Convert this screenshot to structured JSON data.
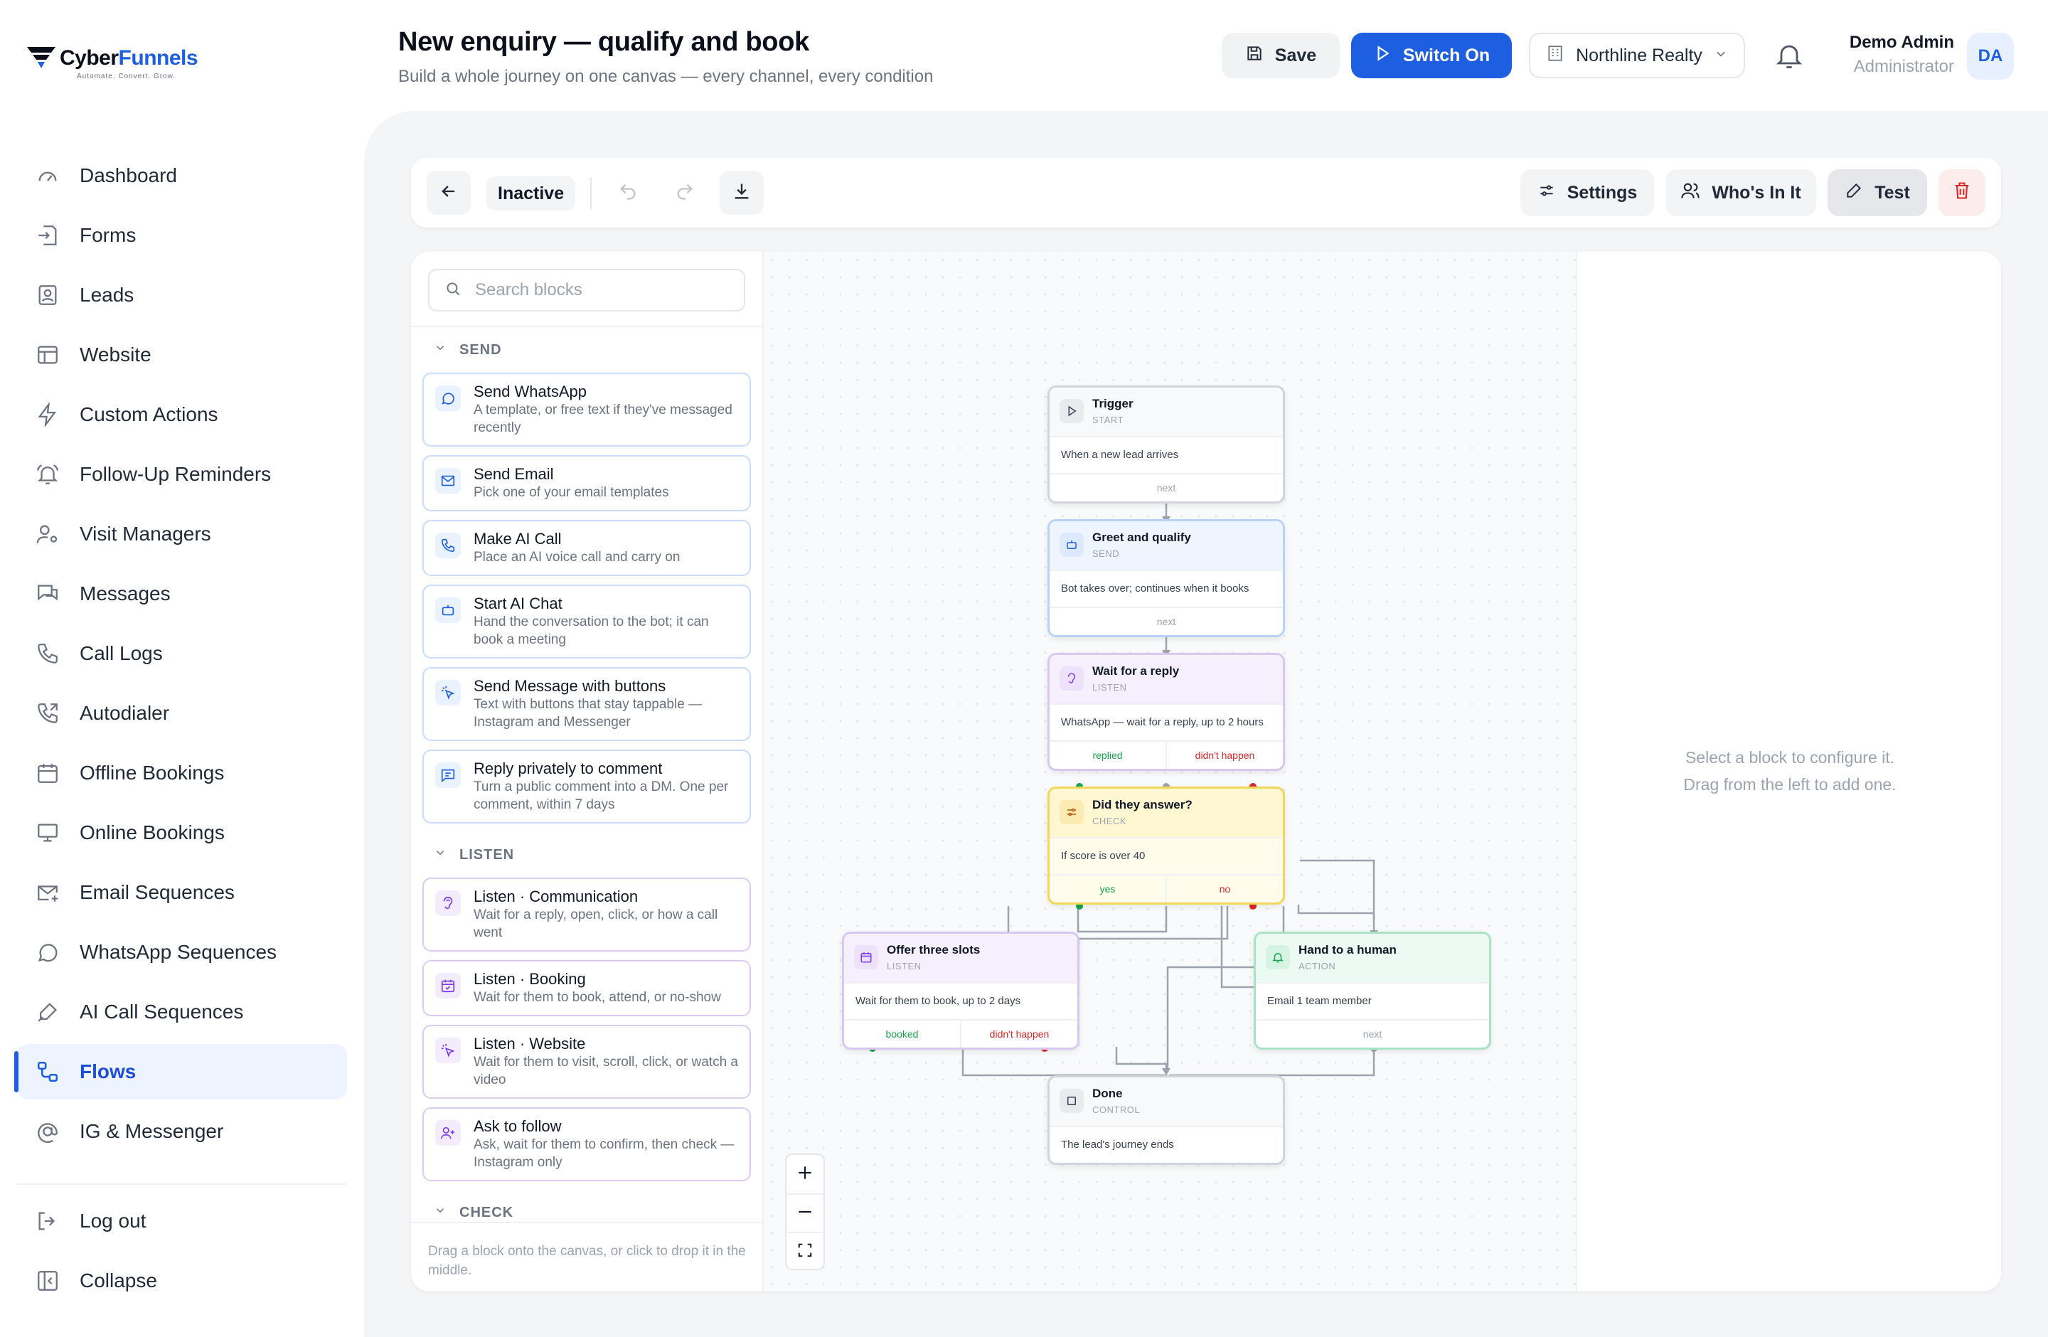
{
  "brand": {
    "name_a": "Cyber",
    "name_b": "Funnels",
    "tagline": "Automate. Convert. Grow."
  },
  "sidebar": {
    "items": [
      {
        "label": "Dashboard",
        "icon": "gauge-icon"
      },
      {
        "label": "Forms",
        "icon": "form-icon"
      },
      {
        "label": "Leads",
        "icon": "contact-card-icon"
      },
      {
        "label": "Website",
        "icon": "layout-icon"
      },
      {
        "label": "Custom Actions",
        "icon": "lightning-icon"
      },
      {
        "label": "Follow-Up Reminders",
        "icon": "bell-ring-icon"
      },
      {
        "label": "Visit Managers",
        "icon": "user-gear-icon"
      },
      {
        "label": "Messages",
        "icon": "chat-bubbles-icon"
      },
      {
        "label": "Call Logs",
        "icon": "phone-icon"
      },
      {
        "label": "Autodialer",
        "icon": "phone-forward-icon"
      },
      {
        "label": "Offline Bookings",
        "icon": "calendar-icon"
      },
      {
        "label": "Online Bookings",
        "icon": "monitor-icon"
      },
      {
        "label": "Email Sequences",
        "icon": "mail-plus-icon"
      },
      {
        "label": "WhatsApp Sequences",
        "icon": "chat-circle-icon"
      },
      {
        "label": "AI Call Sequences",
        "icon": "mic-pen-icon"
      },
      {
        "label": "Flows",
        "icon": "flow-icon",
        "active": true
      },
      {
        "label": "IG & Messenger",
        "icon": "at-sign-icon"
      }
    ],
    "logout": "Log out",
    "collapse": "Collapse"
  },
  "header": {
    "title": "New enquiry — qualify and book",
    "subtitle": "Build a whole journey on one canvas — every channel, every condition",
    "save": "Save",
    "switch_on": "Switch On",
    "org": "Northline Realty",
    "user_name": "Demo Admin",
    "user_role": "Administrator",
    "avatar": "DA"
  },
  "toolbar": {
    "status": "Inactive",
    "settings": "Settings",
    "whos_in_it": "Who's In It",
    "test": "Test"
  },
  "palette": {
    "search_placeholder": "Search blocks",
    "sections": [
      {
        "title": "SEND",
        "kind": "send",
        "blocks": [
          {
            "title": "Send WhatsApp",
            "desc": "A template, or free text if they've messaged recently",
            "icon": "chat-circle-icon"
          },
          {
            "title": "Send Email",
            "desc": "Pick one of your email templates",
            "icon": "mail-icon"
          },
          {
            "title": "Make AI Call",
            "desc": "Place an AI voice call and carry on",
            "icon": "phone-icon"
          },
          {
            "title": "Start AI Chat",
            "desc": "Hand the conversation to the bot; it can book a meeting",
            "icon": "bot-icon"
          },
          {
            "title": "Send Message with buttons",
            "desc": "Text with buttons that stay tappable — Instagram and Messenger",
            "icon": "pointer-click-icon"
          },
          {
            "title": "Reply privately to comment",
            "desc": "Turn a public comment into a DM. One per comment, within 7 days",
            "icon": "message-square-icon"
          }
        ]
      },
      {
        "title": "LISTEN",
        "kind": "listen",
        "blocks": [
          {
            "title": "Listen · Communication",
            "desc": "Wait for a reply, open, click, or how a call went",
            "icon": "ear-icon"
          },
          {
            "title": "Listen · Booking",
            "desc": "Wait for them to book, attend, or no-show",
            "icon": "calendar-check-icon"
          },
          {
            "title": "Listen · Website",
            "desc": "Wait for them to visit, scroll, click, or watch a video",
            "icon": "pointer-click-icon"
          },
          {
            "title": "Ask to follow",
            "desc": "Ask, wait for them to confirm, then check — Instagram only",
            "icon": "user-plus-icon"
          }
        ]
      },
      {
        "title": "CHECK",
        "kind": "check",
        "blocks": []
      }
    ],
    "footer": "Drag a block onto the canvas, or click to drop it in the middle."
  },
  "canvas": {
    "nodes": [
      {
        "id": "trigger",
        "title": "Trigger",
        "kind": "START",
        "body": "When a new lead arrives",
        "outputs": [
          "next"
        ]
      },
      {
        "id": "greet",
        "title": "Greet and qualify",
        "kind": "SEND",
        "body": "Bot takes over; continues when it books",
        "outputs": [
          "next"
        ]
      },
      {
        "id": "wait",
        "title": "Wait for a reply",
        "kind": "LISTEN",
        "body": "WhatsApp — wait for a reply, up to 2 hours",
        "outputs": [
          "replied",
          "didn't happen"
        ]
      },
      {
        "id": "check",
        "title": "Did they answer?",
        "kind": "CHECK",
        "body": "If score is over 40",
        "outputs": [
          "yes",
          "no"
        ]
      },
      {
        "id": "offer",
        "title": "Offer three slots",
        "kind": "LISTEN",
        "body": "Wait for them to book, up to 2 days",
        "outputs": [
          "booked",
          "didn't happen"
        ]
      },
      {
        "id": "human",
        "title": "Hand to a human",
        "kind": "ACTION",
        "body": "Email 1 team member",
        "outputs": [
          "next"
        ]
      },
      {
        "id": "done",
        "title": "Done",
        "kind": "CONTROL",
        "body": "The lead's journey ends",
        "outputs": []
      }
    ]
  },
  "config_panel": {
    "line1": "Select a block to configure it.",
    "line2": "Drag from the left to add one."
  },
  "colors": {
    "accent": "#1d5fe0",
    "success": "#16a34a",
    "danger": "#dc2626"
  }
}
